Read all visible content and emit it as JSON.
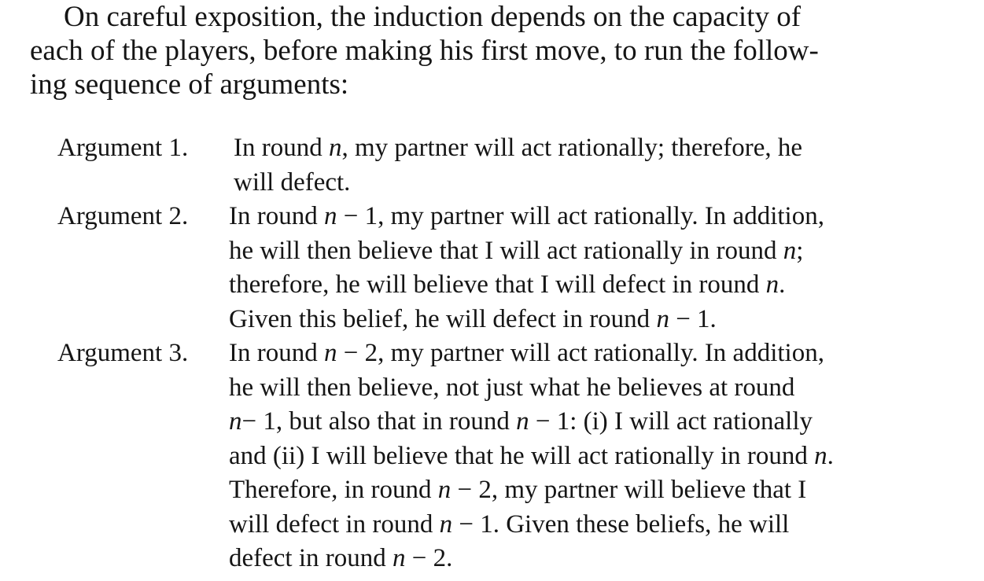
{
  "intro": {
    "lines": [
      "On careful exposition, the induction depends on the capacity of",
      "each of the players, before making his first move, to run the follow-",
      "ing sequence of arguments:"
    ]
  },
  "arguments": [
    {
      "label": "Argument 1.",
      "lines": [
        "In round n, my partner will act rationally; therefore, he",
        "will defect."
      ]
    },
    {
      "label": "Argument 2.",
      "lines": [
        "In round n − 1, my partner will act rationally. In addition,",
        "he will then believe that I will act rationally in round n;",
        "therefore, he will believe that I will defect in round n.",
        "Given this belief, he will defect in round n − 1."
      ]
    },
    {
      "label": "Argument 3.",
      "lines": [
        "In round n − 2, my partner will act rationally. In addition,",
        "he will then believe, not just what he believes at round",
        "n− 1, but also that in round n − 1: (i) I will act rationally",
        "and (ii) I will believe that he will act rationally in round n.",
        "Therefore, in round n − 2, my partner will believe that I",
        "will defect in round n − 1. Given these beliefs, he will",
        "defect in round n − 2."
      ]
    }
  ]
}
